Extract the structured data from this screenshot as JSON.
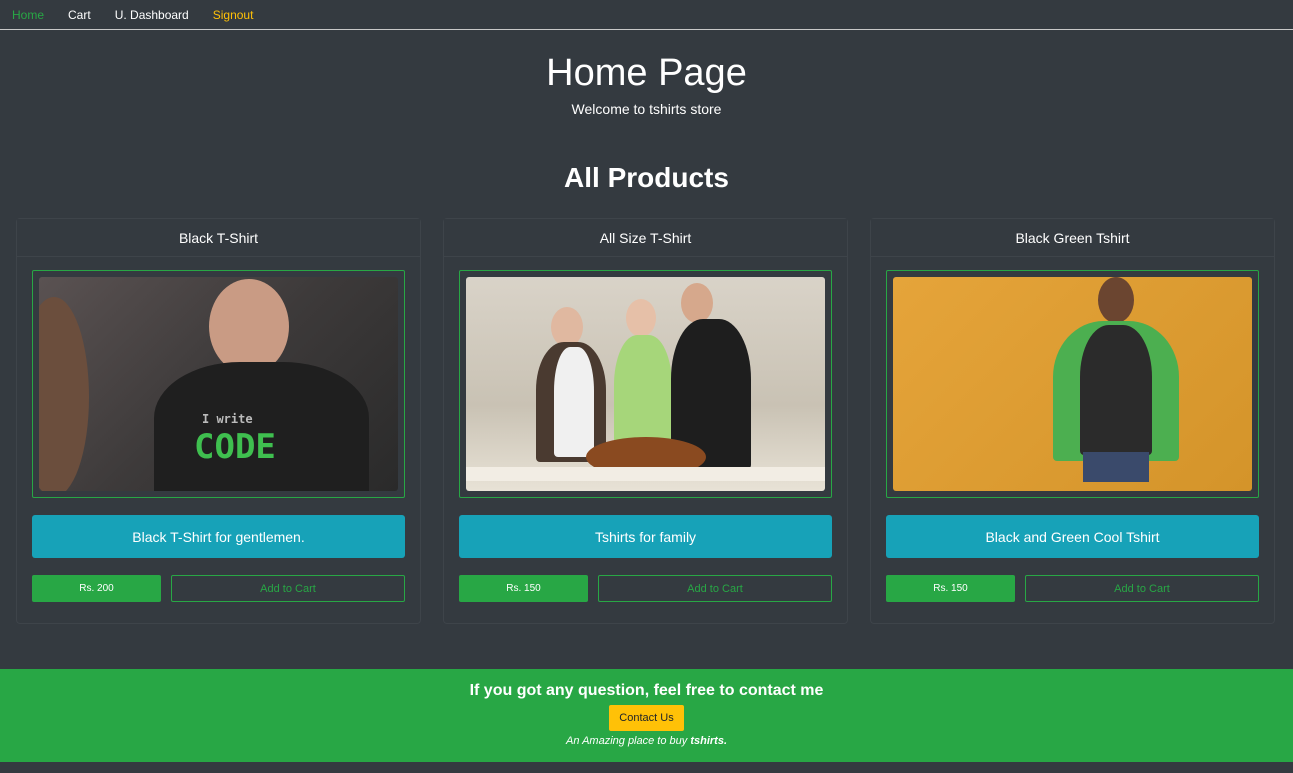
{
  "nav": {
    "home": "Home",
    "cart": "Cart",
    "dashboard": "U. Dashboard",
    "signout": "Signout"
  },
  "hero": {
    "title": "Home Page",
    "subtitle": "Welcome to tshirts store"
  },
  "section_title": "All Products",
  "products": [
    {
      "name": "Black T-Shirt",
      "description": "Black T-Shirt for gentlemen.",
      "price": "Rs. 200",
      "button": "Add to Cart"
    },
    {
      "name": "All Size T-Shirt",
      "description": "Tshirts for family",
      "price": "Rs. 150",
      "button": "Add to Cart"
    },
    {
      "name": "Black Green Tshirt",
      "description": "Black and Green Cool Tshirt",
      "price": "Rs. 150",
      "button": "Add to Cart"
    }
  ],
  "shirt_print": {
    "small": "I write",
    "big": "CODE"
  },
  "footer": {
    "heading": "If you got any question, feel free to contact me",
    "contact_button": "Contact Us",
    "tagline_prefix": "An Amazing place to buy",
    "tagline_bold": "tshirts."
  },
  "colors": {
    "background": "#343a40",
    "success": "#28a745",
    "info": "#17a2b8",
    "warning": "#ffc107"
  }
}
